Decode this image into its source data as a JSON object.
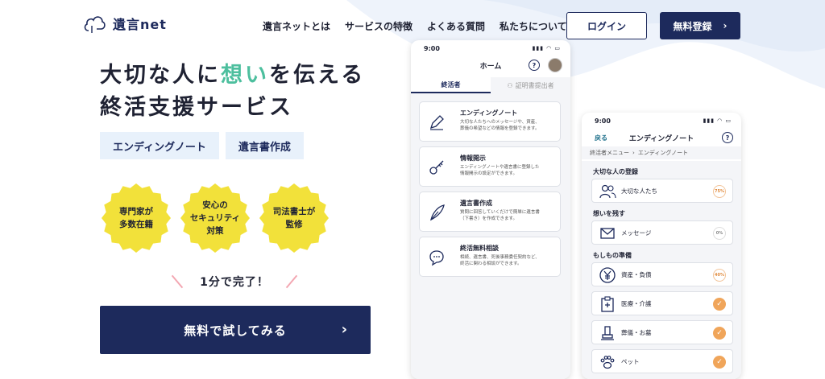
{
  "header": {
    "logo_text": "遺言net",
    "nav": [
      "遺言ネットとは",
      "サービスの特徴",
      "よくある質問",
      "私たちについて"
    ],
    "login_label": "ログイン",
    "register_label": "無料登録"
  },
  "hero": {
    "line1_pre": "大切な人に",
    "line1_accent": "想い",
    "line1_post": "を伝える",
    "line2": "終活支援サービス"
  },
  "tags": [
    "エンディングノート",
    "遺言書作成"
  ],
  "badges": [
    "専門家が\n多数在籍",
    "安心の\nセキュリティ\n対策",
    "司法書士が\n監修"
  ],
  "complete_text": "1分で完了！",
  "cta_label": "無料で試してみる",
  "phone1": {
    "time": "9:00",
    "title": "ホーム",
    "tabs": [
      "終活者",
      "証明書提出者"
    ],
    "cards": [
      {
        "title": "エンディングノート",
        "desc": "大切な人たちへのメッセージや、資産、\n葬儀の希望などの情報を登録できます。"
      },
      {
        "title": "情報開示",
        "desc": "エンディングノートや遺言書に登録した\n情報開示の設定ができます。"
      },
      {
        "title": "遺言書作成",
        "desc": "質問に回答していくだけで簡単に遺言書\n（下書き）を作成できます。"
      },
      {
        "title": "終活無料相談",
        "desc": "相続、遺言書、死後事務委任契約など、\n終活に関わる相談ができます。"
      }
    ]
  },
  "phone2": {
    "time": "9:00",
    "back": "戻る",
    "title": "エンディングノート",
    "crumb_parent": "終活者メニュー",
    "crumb_current": "エンディングノート",
    "sections": [
      {
        "title": "大切な人の登録",
        "rows": [
          {
            "label": "大切な人たち",
            "progress": "75%"
          }
        ]
      },
      {
        "title": "想いを残す",
        "rows": [
          {
            "label": "メッセージ",
            "progress": "0%"
          }
        ]
      },
      {
        "title": "もしもの準備",
        "rows": [
          {
            "label": "資産・負債",
            "progress": "40%"
          },
          {
            "label": "医療・介護",
            "progress": "done"
          },
          {
            "label": "葬儀・お墓",
            "progress": "done"
          },
          {
            "label": "ペット",
            "progress": "done"
          }
        ]
      }
    ]
  },
  "colors": {
    "navy": "#1d2a5c",
    "accent": "#4dbf9e",
    "badge": "#f2e13a",
    "tag_bg": "#e8f1fb",
    "check": "#f0a55a"
  }
}
